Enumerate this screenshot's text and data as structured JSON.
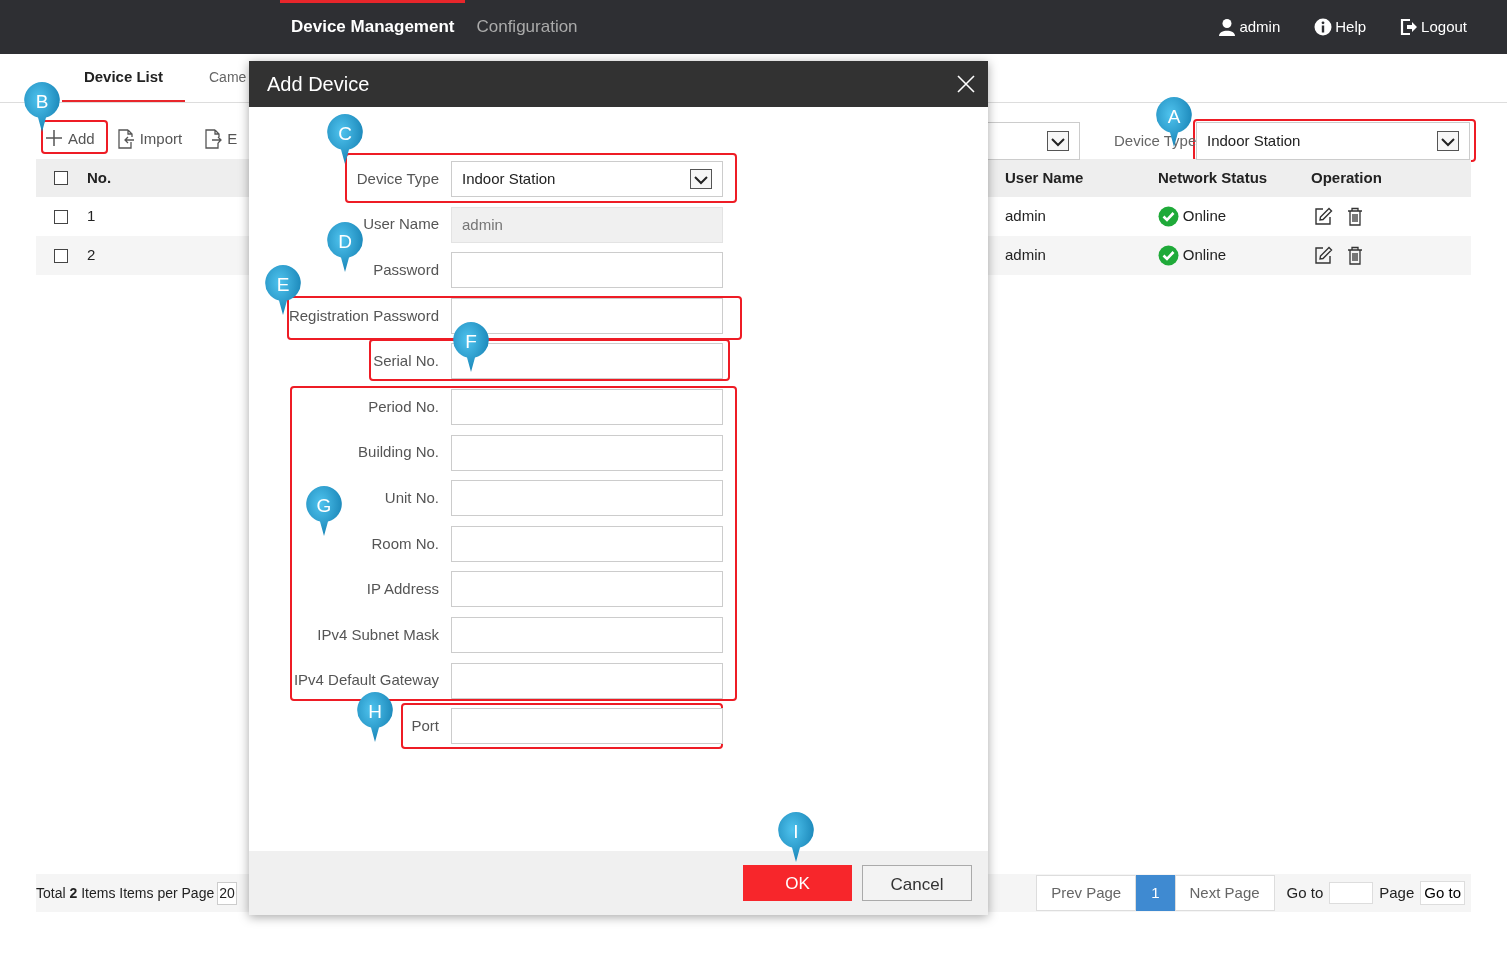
{
  "topbar": {
    "nav": [
      {
        "label": "Device Management",
        "selected": true
      },
      {
        "label": "Configuration",
        "selected": false
      }
    ],
    "links": [
      {
        "label": "admin",
        "kind": "user"
      },
      {
        "label": "Help",
        "kind": "help"
      },
      {
        "label": "Logout",
        "kind": "logout"
      }
    ]
  },
  "tabs": [
    {
      "label": "Device List",
      "selected": true
    },
    {
      "label": "Came",
      "selected": false
    }
  ],
  "toolbar": [
    {
      "label": "Add",
      "kind": "add"
    },
    {
      "label": "Import",
      "kind": "import"
    },
    {
      "label": "E",
      "kind": "export"
    }
  ],
  "filter": {
    "label": "Device Type",
    "value": "Indoor Station"
  },
  "table": {
    "all_checked": false,
    "columns": [
      "No.",
      "User Name",
      "Network Status",
      "Operation"
    ],
    "rows": [
      {
        "checked": false,
        "no": "1",
        "user_name": "admin",
        "status": "Online",
        "online": true
      },
      {
        "checked": false,
        "no": "2",
        "user_name": "admin",
        "status": "Online",
        "online": true
      }
    ]
  },
  "footer": {
    "summary": "Total **2** Items Items per Page",
    "per_page": "20",
    "prev": "Prev Page",
    "pages": [
      {
        "label": "1",
        "selected": true
      }
    ],
    "next": "Next Page",
    "goto_label": "Go to",
    "page_label": "Page",
    "goto_button": "Go to"
  },
  "dialog": {
    "title": "Add Device",
    "fields": [
      {
        "label": "Device Type",
        "kind": "select",
        "value": "Indoor Station"
      },
      {
        "label": "User Name",
        "kind": "text",
        "placeholder": "admin",
        "disabled": true
      },
      {
        "label": "Password",
        "kind": "text",
        "disabled": false
      },
      {
        "label": "Registration Password",
        "kind": "text",
        "disabled": false
      },
      {
        "label": "Serial No.",
        "kind": "text",
        "disabled": false
      },
      {
        "label": "Period No.",
        "kind": "text",
        "disabled": false
      },
      {
        "label": "Building No.",
        "kind": "text",
        "disabled": false
      },
      {
        "label": "Unit No.",
        "kind": "text",
        "disabled": false
      },
      {
        "label": "Room No.",
        "kind": "text",
        "disabled": false
      },
      {
        "label": "IP Address",
        "kind": "text",
        "disabled": false
      },
      {
        "label": "IPv4 Subnet Mask",
        "kind": "text",
        "disabled": false
      },
      {
        "label": "IPv4 Default Gateway",
        "kind": "text",
        "disabled": false
      },
      {
        "label": "Port",
        "kind": "text",
        "disabled": false
      }
    ],
    "buttons": [
      {
        "label": "OK",
        "kind": "primary"
      },
      {
        "label": "Cancel",
        "kind": "secondary"
      }
    ]
  },
  "markers": [
    {
      "letter": "A"
    },
    {
      "letter": "B"
    },
    {
      "letter": "C"
    },
    {
      "letter": "D"
    },
    {
      "letter": "E"
    },
    {
      "letter": "F"
    },
    {
      "letter": "G"
    },
    {
      "letter": "H"
    },
    {
      "letter": "I"
    }
  ]
}
